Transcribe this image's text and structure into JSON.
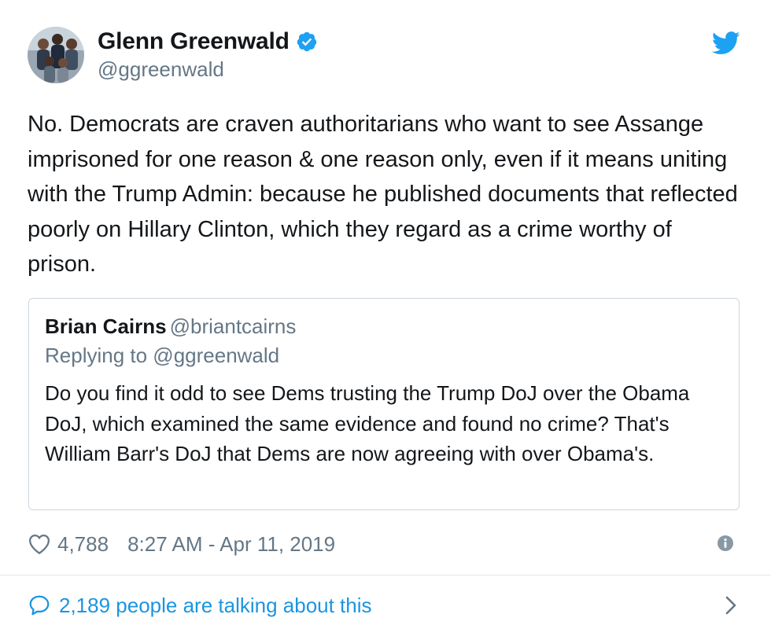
{
  "author": {
    "display_name": "Glenn Greenwald",
    "handle": "@ggreenwald",
    "verified": true
  },
  "tweet": {
    "text": "No. Democrats are craven authoritarians who want to see Assange imprisoned for one reason & one reason only, even if it means uniting with the Trump Admin: because he published documents that reflected poorly on Hillary Clinton, which they regard as a crime worthy of prison."
  },
  "quoted_tweet": {
    "display_name": "Brian Cairns",
    "handle": "@briantcairns",
    "replying_to": "Replying to @ggreenwald",
    "text": "Do you find it odd to see Dems trusting the Trump DoJ over the Obama DoJ, which examined the same evidence and found no crime? That's William Barr's DoJ that Dems are now agreeing with over Obama's."
  },
  "meta": {
    "likes": "4,788",
    "timestamp": "8:27 AM - Apr 11, 2019"
  },
  "footer": {
    "talking": "2,189 people are talking about this"
  },
  "icons": {
    "verified": "verified-badge-icon",
    "bird": "twitter-bird-icon",
    "like": "heart-icon",
    "info": "info-icon",
    "reply": "speech-bubble-icon",
    "chevron": "chevron-right-icon"
  },
  "colors": {
    "brand_blue": "#1da1f2",
    "link_blue": "#1b95e0",
    "secondary_text": "#657786",
    "border": "#ccd6dd"
  }
}
